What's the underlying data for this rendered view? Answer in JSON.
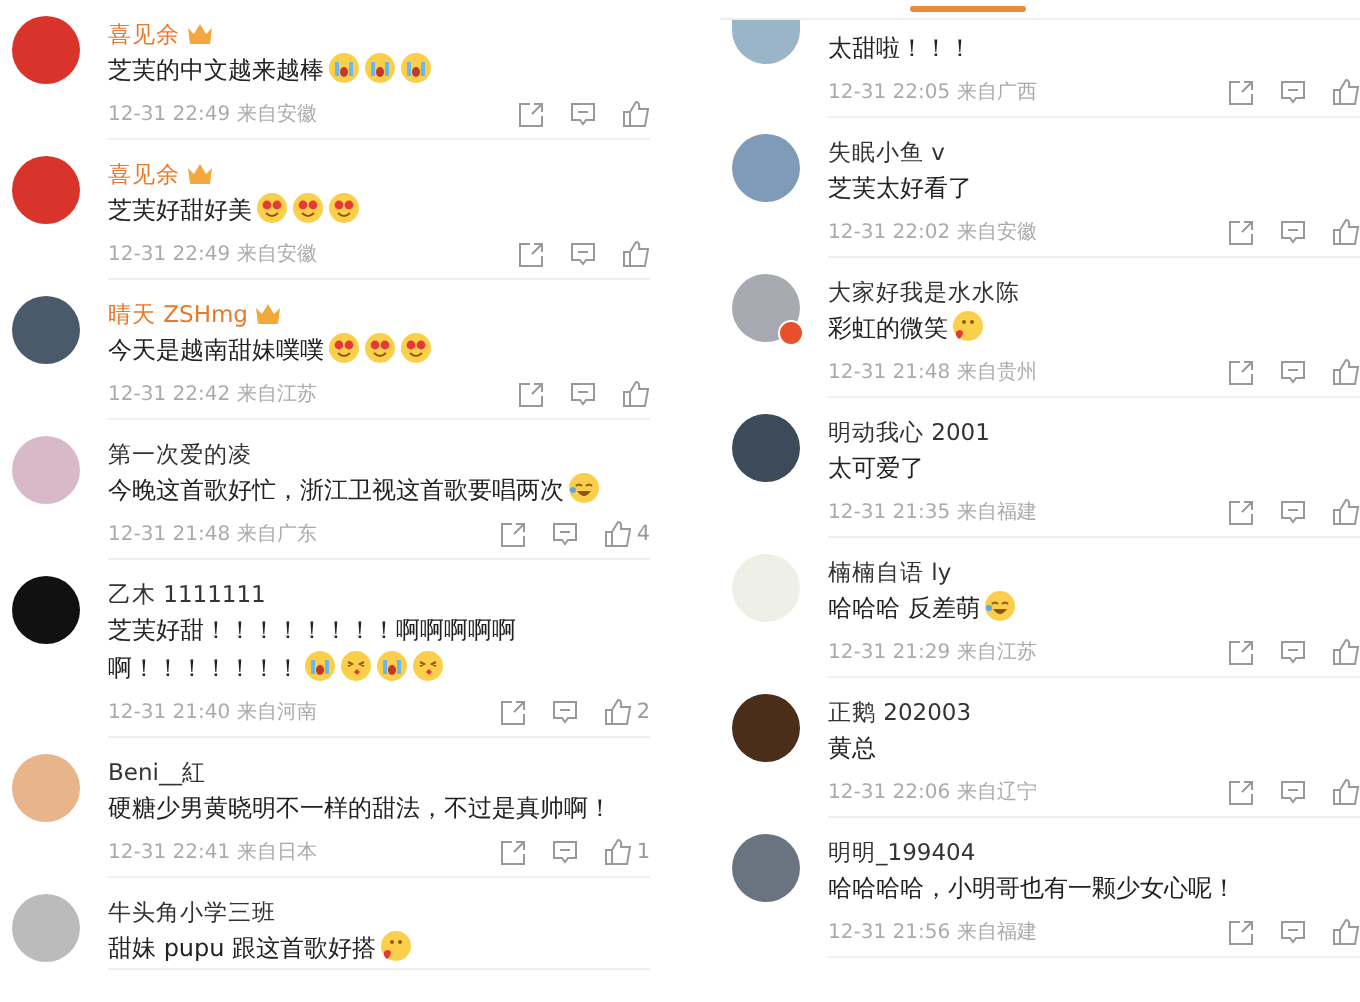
{
  "left_panel": {
    "comments": [
      {
        "user": "喜见余",
        "vip": true,
        "text": "芝芙的中文越来越棒",
        "emojis": [
          {
            "kind": "tears"
          },
          {
            "kind": "tears"
          },
          {
            "kind": "tears"
          }
        ],
        "time": "12-31 22:49",
        "location": "来自安徽"
      },
      {
        "user": "喜见余",
        "vip": true,
        "text": "芝芙好甜好美",
        "emojis": [
          {
            "kind": "heart-eyes"
          },
          {
            "kind": "heart-eyes"
          },
          {
            "kind": "heart-eyes"
          }
        ],
        "time": "12-31 22:49",
        "location": "来自安徽"
      },
      {
        "user": "晴天 ZSHmg",
        "vip": true,
        "text": "今天是越南甜妹噗噗",
        "emojis": [
          {
            "kind": "heart-eyes"
          },
          {
            "kind": "heart-eyes"
          },
          {
            "kind": "heart-eyes"
          }
        ],
        "time": "12-31 22:42",
        "location": "来自江苏"
      },
      {
        "user": "第一次爱的凌",
        "vip": false,
        "text": "今晚这首歌好忙，浙江卫视这首歌要唱两次",
        "emojis": [
          {
            "kind": "lol"
          }
        ],
        "time": "12-31 21:48",
        "location": "来自广东",
        "likes": "4"
      },
      {
        "user": "乙木 1111111",
        "vip": false,
        "text": "芝芙好甜！！！！！！！！啊啊啊啊啊啊！！！！！！！",
        "emojis": [
          {
            "kind": "tears"
          },
          {
            "kind": "kiss"
          },
          {
            "kind": "tears"
          },
          {
            "kind": "kiss"
          }
        ],
        "time": "12-31 21:40",
        "location": "来自河南",
        "likes": "2"
      },
      {
        "user": "Beni__紅",
        "vip": false,
        "text": "硬糖少男黄晓明不一样的甜法，不过是真帅啊！",
        "time": "12-31 22:41",
        "location": "来自日本",
        "likes": "1"
      },
      {
        "user": "牛头角小学三班",
        "vip": false,
        "text": "甜妹 pupu 跟这首歌好搭",
        "emojis": [
          {
            "kind": "heart-face"
          }
        ]
      }
    ]
  },
  "right_panel": {
    "comments": [
      {
        "partial": true,
        "text": "太甜啦！！！",
        "time": "12-31 22:05",
        "location": "来自广西"
      },
      {
        "user": "失眠小鱼 v",
        "text": "芝芙太好看了",
        "time": "12-31 22:02",
        "location": "来自安徽"
      },
      {
        "badge": true,
        "user": "大家好我是水水陈",
        "text": "彩虹的微笑",
        "emojis": [
          {
            "kind": "heart-face"
          }
        ],
        "time": "12-31 21:48",
        "location": "来自贵州"
      },
      {
        "user": "明动我心 2001",
        "text": "太可爱了",
        "time": "12-31 21:35",
        "location": "来自福建"
      },
      {
        "user": "楠楠自语 ly",
        "text": "哈哈哈 反差萌",
        "emojis": [
          {
            "kind": "lol"
          }
        ],
        "time": "12-31 21:29",
        "location": "来自江苏"
      },
      {
        "user": "正鹅 202003",
        "text": "黄总",
        "time": "12-31 22:06",
        "location": "来自辽宁"
      },
      {
        "user": "明明_199404",
        "text": "哈哈哈哈，小明哥也有一颗少女心呢！",
        "time": "12-31 21:56",
        "location": "来自福建"
      }
    ]
  }
}
